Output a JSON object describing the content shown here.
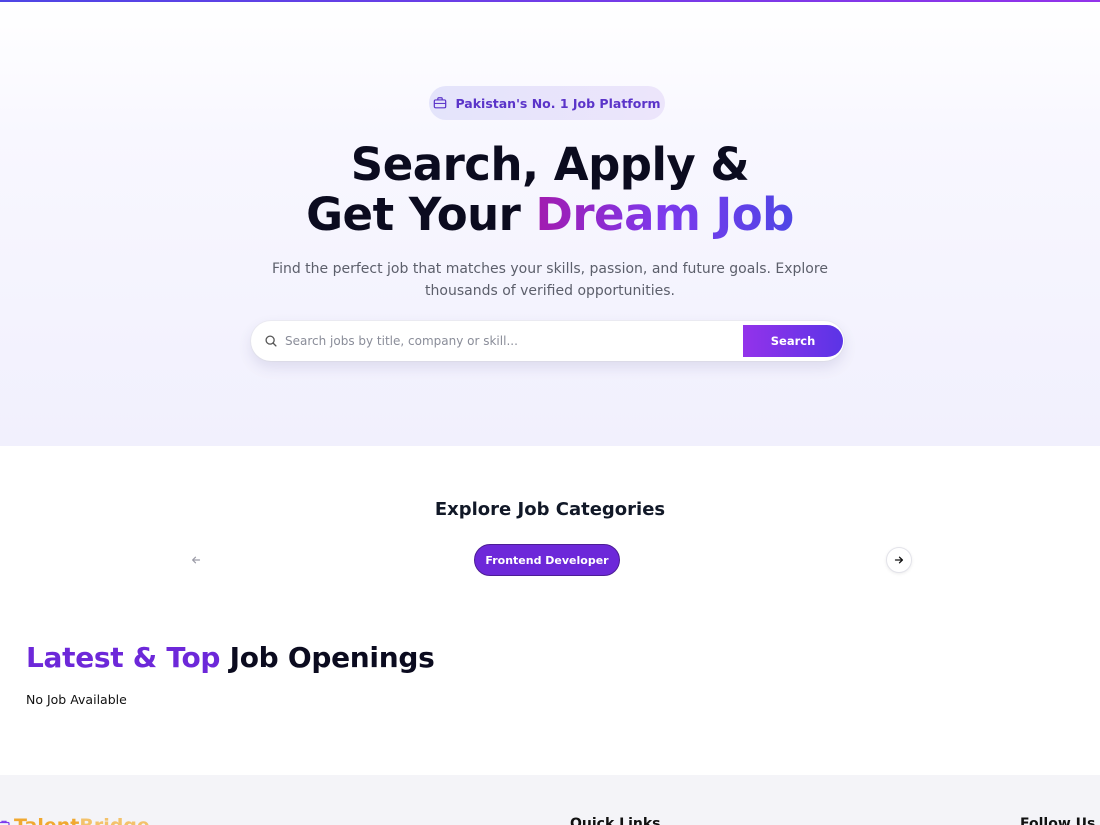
{
  "hero": {
    "badge_text": "Pakistan's No. 1 Job Platform",
    "title_line1": "Search, Apply &",
    "title_line2_prefix": "Get Your ",
    "title_line2_accent": "Dream Job",
    "subtitle": "Find the perfect job that matches your skills, passion, and future goals. Explore thousands of verified opportunities."
  },
  "search": {
    "placeholder": "Search jobs by title, company or skill...",
    "value": "",
    "button_label": "Search"
  },
  "categories": {
    "title": "Explore Job Categories",
    "items": [
      {
        "label": "Frontend Developer"
      }
    ],
    "prev_icon": "arrow-left-icon",
    "next_icon": "arrow-right-icon"
  },
  "latest": {
    "title_accent": "Latest & Top",
    "title_rest": " Job Openings",
    "empty_text": "No Job Available"
  },
  "footer": {
    "brand_part1": "Talent",
    "brand_part2": "Bridge",
    "quick_links": "Quick Links",
    "follow_us": "Follow Us"
  },
  "colors": {
    "accent_purple": "#6d28d9",
    "gradient_start": "#9333ea",
    "gradient_end": "#4f46e5",
    "brand_orange": "#f0a830"
  }
}
